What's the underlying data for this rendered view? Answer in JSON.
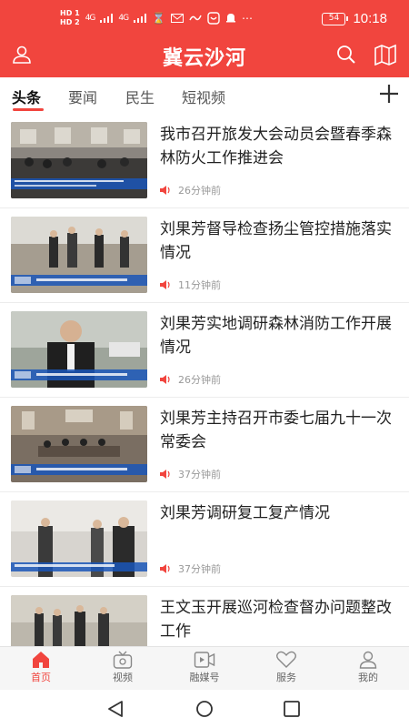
{
  "status_bar": {
    "hd_top": "HD 1",
    "hd_bottom": "HD 2",
    "signal_1": "4G",
    "signal_2": "4G",
    "battery": "54",
    "time": "10:18"
  },
  "header": {
    "title": "冀云沙河"
  },
  "tabs": [
    {
      "label": "头条",
      "active": true
    },
    {
      "label": "要闻",
      "active": false
    },
    {
      "label": "民生",
      "active": false
    },
    {
      "label": "短视频",
      "active": false
    }
  ],
  "news": [
    {
      "title": "我市召开旅发大会动员会暨春季森林防火工作推进会",
      "time": "26分钟前"
    },
    {
      "title": "刘果芳督导检查扬尘管控措施落实情况",
      "time": "11分钟前"
    },
    {
      "title": "刘果芳实地调研森林消防工作开展情况",
      "time": "26分钟前"
    },
    {
      "title": "刘果芳主持召开市委七届九十一次常委会",
      "time": "37分钟前"
    },
    {
      "title": "刘果芳调研复工复产情况",
      "time": "37分钟前"
    },
    {
      "title": "王文玉开展巡河检查督办问题整改工作",
      "time": ""
    }
  ],
  "bottom_nav": [
    {
      "label": "首页",
      "icon": "home-icon",
      "active": true
    },
    {
      "label": "视频",
      "icon": "tv-icon",
      "active": false
    },
    {
      "label": "融媒号",
      "icon": "video-play-icon",
      "active": false
    },
    {
      "label": "服务",
      "icon": "heart-icon",
      "active": false
    },
    {
      "label": "我的",
      "icon": "user-icon",
      "active": false
    }
  ],
  "colors": {
    "brand": "#f1453e",
    "text": "#222222",
    "muted": "#999999"
  }
}
